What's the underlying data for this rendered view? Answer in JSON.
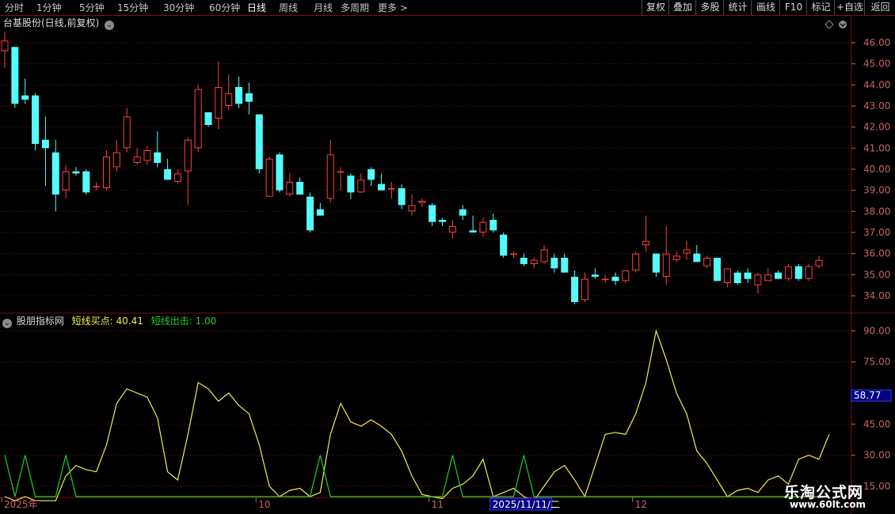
{
  "toolbar": {
    "periods": [
      {
        "label": "分时",
        "active": false
      },
      {
        "label": "1分钟",
        "active": false
      },
      {
        "label": "5分钟",
        "active": false
      },
      {
        "label": "15分钟",
        "active": false
      },
      {
        "label": "30分钟",
        "active": false
      },
      {
        "label": "60分钟",
        "active": false
      },
      {
        "label": "日线",
        "active": true
      },
      {
        "label": "周线",
        "active": false
      },
      {
        "label": "月线",
        "active": false
      },
      {
        "label": "多周期",
        "active": false
      },
      {
        "label": "更多 >",
        "active": false
      }
    ],
    "tools": [
      "复权",
      "叠加",
      "多股",
      "统计",
      "画线",
      "F10",
      "标记",
      "+自选",
      "返回"
    ]
  },
  "main_header": {
    "title": "台基股份(日线,前复权)",
    "dropdown_icon": "chevron-down-icon"
  },
  "sub_header": {
    "title": "股朋指标网",
    "l1_label": "短线买点: 40.41",
    "l2_label": "短线出击: 1.00"
  },
  "colors": {
    "up": "#ff4040",
    "down": "#54fcfc",
    "line1": "#f0f050",
    "line2": "#20d020",
    "grid": "#7a1010",
    "axis": "#c86464"
  },
  "chart_data": [
    {
      "type": "candlestick",
      "title": "台基股份(日线,前复权)",
      "ylim": [
        33.4,
        46.6
      ],
      "yticks": [
        34,
        35,
        36,
        37,
        38,
        39,
        40,
        41,
        42,
        43,
        44,
        45,
        46
      ],
      "ytick_labels": [
        "34.00",
        "35.00",
        "36.00",
        "37.00",
        "38.00",
        "39.00",
        "40.00",
        "41.00",
        "42.00",
        "43.00",
        "44.00",
        "45.00",
        "46.00"
      ],
      "candles": [
        {
          "o": 45.6,
          "h": 46.5,
          "l": 44.8,
          "c": 46.1
        },
        {
          "o": 45.8,
          "h": 45.8,
          "l": 42.9,
          "c": 43.1
        },
        {
          "o": 43.5,
          "h": 44.3,
          "l": 43.1,
          "c": 43.3
        },
        {
          "o": 43.5,
          "h": 43.6,
          "l": 40.9,
          "c": 41.2
        },
        {
          "o": 41.4,
          "h": 42.5,
          "l": 39.2,
          "c": 41.0
        },
        {
          "o": 40.8,
          "h": 41.4,
          "l": 38.0,
          "c": 38.8
        },
        {
          "o": 39.0,
          "h": 40.2,
          "l": 38.6,
          "c": 39.9
        },
        {
          "o": 39.9,
          "h": 40.1,
          "l": 39.7,
          "c": 39.8
        },
        {
          "o": 39.9,
          "h": 40.0,
          "l": 38.8,
          "c": 38.9
        },
        {
          "o": 39.2,
          "h": 39.4,
          "l": 39.0,
          "c": 39.2
        },
        {
          "o": 39.1,
          "h": 40.9,
          "l": 39.0,
          "c": 40.6
        },
        {
          "o": 40.1,
          "h": 41.4,
          "l": 39.9,
          "c": 40.8
        },
        {
          "o": 41.0,
          "h": 42.9,
          "l": 40.8,
          "c": 42.5
        },
        {
          "o": 40.3,
          "h": 41.0,
          "l": 40.2,
          "c": 40.6
        },
        {
          "o": 40.4,
          "h": 41.1,
          "l": 40.2,
          "c": 40.9
        },
        {
          "o": 40.8,
          "h": 41.8,
          "l": 40.1,
          "c": 40.3
        },
        {
          "o": 40.0,
          "h": 40.5,
          "l": 39.5,
          "c": 39.5
        },
        {
          "o": 39.4,
          "h": 40.0,
          "l": 39.3,
          "c": 39.8
        },
        {
          "o": 39.9,
          "h": 41.5,
          "l": 38.3,
          "c": 41.4
        },
        {
          "o": 41.0,
          "h": 44.0,
          "l": 40.8,
          "c": 43.8
        },
        {
          "o": 42.7,
          "h": 42.7,
          "l": 42.0,
          "c": 42.1
        },
        {
          "o": 42.4,
          "h": 45.1,
          "l": 41.9,
          "c": 43.9
        },
        {
          "o": 43.0,
          "h": 44.5,
          "l": 42.8,
          "c": 43.6
        },
        {
          "o": 43.9,
          "h": 44.4,
          "l": 42.9,
          "c": 43.1
        },
        {
          "o": 43.6,
          "h": 44.1,
          "l": 42.6,
          "c": 43.2
        },
        {
          "o": 42.6,
          "h": 42.6,
          "l": 39.8,
          "c": 40.0
        },
        {
          "o": 38.7,
          "h": 40.6,
          "l": 38.7,
          "c": 40.5
        },
        {
          "o": 40.7,
          "h": 40.8,
          "l": 38.9,
          "c": 39.0
        },
        {
          "o": 38.8,
          "h": 39.8,
          "l": 38.7,
          "c": 39.4
        },
        {
          "o": 39.4,
          "h": 39.6,
          "l": 38.8,
          "c": 38.8
        },
        {
          "o": 38.7,
          "h": 38.9,
          "l": 37.0,
          "c": 37.1
        },
        {
          "o": 38.1,
          "h": 38.4,
          "l": 37.9,
          "c": 37.8
        },
        {
          "o": 38.6,
          "h": 41.4,
          "l": 38.4,
          "c": 40.7
        },
        {
          "o": 39.9,
          "h": 40.1,
          "l": 39.0,
          "c": 39.9
        },
        {
          "o": 39.7,
          "h": 39.8,
          "l": 38.6,
          "c": 38.9
        },
        {
          "o": 38.9,
          "h": 39.8,
          "l": 38.9,
          "c": 39.5
        },
        {
          "o": 40.0,
          "h": 40.1,
          "l": 39.2,
          "c": 39.5
        },
        {
          "o": 39.3,
          "h": 39.8,
          "l": 39.0,
          "c": 39.0
        },
        {
          "o": 39.1,
          "h": 39.4,
          "l": 38.6,
          "c": 39.1
        },
        {
          "o": 39.1,
          "h": 39.3,
          "l": 38.1,
          "c": 38.3
        },
        {
          "o": 38.0,
          "h": 38.8,
          "l": 37.8,
          "c": 38.3
        },
        {
          "o": 38.4,
          "h": 38.6,
          "l": 38.2,
          "c": 38.5
        },
        {
          "o": 38.3,
          "h": 38.4,
          "l": 37.3,
          "c": 37.5
        },
        {
          "o": 37.6,
          "h": 37.7,
          "l": 37.3,
          "c": 37.5
        },
        {
          "o": 37.0,
          "h": 37.6,
          "l": 36.7,
          "c": 37.3
        },
        {
          "o": 38.1,
          "h": 38.3,
          "l": 37.6,
          "c": 37.8
        },
        {
          "o": 37.1,
          "h": 37.8,
          "l": 37.0,
          "c": 37.0
        },
        {
          "o": 37.0,
          "h": 37.7,
          "l": 36.8,
          "c": 37.5
        },
        {
          "o": 37.6,
          "h": 37.9,
          "l": 37.0,
          "c": 37.1
        },
        {
          "o": 36.9,
          "h": 37.0,
          "l": 35.8,
          "c": 35.9
        },
        {
          "o": 36.0,
          "h": 36.1,
          "l": 35.8,
          "c": 36.0
        },
        {
          "o": 35.8,
          "h": 36.0,
          "l": 35.4,
          "c": 35.5
        },
        {
          "o": 35.5,
          "h": 35.8,
          "l": 35.3,
          "c": 35.7
        },
        {
          "o": 35.6,
          "h": 36.4,
          "l": 35.5,
          "c": 36.2
        },
        {
          "o": 35.8,
          "h": 36.0,
          "l": 35.1,
          "c": 35.3
        },
        {
          "o": 35.8,
          "h": 36.0,
          "l": 35.1,
          "c": 35.1
        },
        {
          "o": 34.9,
          "h": 35.2,
          "l": 33.6,
          "c": 33.7
        },
        {
          "o": 33.8,
          "h": 35.1,
          "l": 33.7,
          "c": 34.8
        },
        {
          "o": 35.0,
          "h": 35.3,
          "l": 34.8,
          "c": 34.9
        },
        {
          "o": 34.8,
          "h": 35.0,
          "l": 34.6,
          "c": 34.8
        },
        {
          "o": 34.9,
          "h": 35.1,
          "l": 34.5,
          "c": 34.7
        },
        {
          "o": 34.7,
          "h": 35.1,
          "l": 34.6,
          "c": 35.2
        },
        {
          "o": 35.2,
          "h": 36.1,
          "l": 35.1,
          "c": 36.0
        },
        {
          "o": 36.4,
          "h": 37.8,
          "l": 36.1,
          "c": 36.6
        },
        {
          "o": 36.0,
          "h": 36.0,
          "l": 34.9,
          "c": 35.1
        },
        {
          "o": 34.9,
          "h": 37.3,
          "l": 34.5,
          "c": 36.0
        },
        {
          "o": 35.7,
          "h": 36.1,
          "l": 35.6,
          "c": 35.9
        },
        {
          "o": 36.0,
          "h": 36.6,
          "l": 35.7,
          "c": 36.2
        },
        {
          "o": 36.0,
          "h": 36.4,
          "l": 35.6,
          "c": 35.6
        },
        {
          "o": 35.4,
          "h": 35.9,
          "l": 35.3,
          "c": 35.8
        },
        {
          "o": 35.8,
          "h": 35.8,
          "l": 34.8,
          "c": 34.7
        },
        {
          "o": 34.6,
          "h": 35.3,
          "l": 34.4,
          "c": 35.3
        },
        {
          "o": 35.1,
          "h": 35.2,
          "l": 34.5,
          "c": 34.6
        },
        {
          "o": 35.1,
          "h": 35.3,
          "l": 34.6,
          "c": 34.8
        },
        {
          "o": 34.5,
          "h": 35.1,
          "l": 34.1,
          "c": 35.0
        },
        {
          "o": 34.7,
          "h": 35.3,
          "l": 34.7,
          "c": 35.0
        },
        {
          "o": 35.1,
          "h": 35.2,
          "l": 34.8,
          "c": 34.8
        },
        {
          "o": 34.8,
          "h": 35.5,
          "l": 34.7,
          "c": 35.4
        },
        {
          "o": 35.4,
          "h": 35.5,
          "l": 34.7,
          "c": 34.8
        },
        {
          "o": 34.8,
          "h": 35.5,
          "l": 34.7,
          "c": 35.4
        },
        {
          "o": 35.4,
          "h": 35.9,
          "l": 35.3,
          "c": 35.7
        }
      ]
    },
    {
      "type": "line",
      "title": "股朋指标网",
      "ylim": [
        10,
        97
      ],
      "yticks": [
        15,
        30,
        45,
        75,
        90
      ],
      "ytick_labels": [
        "15.00",
        "30.00",
        "45.00",
        "75.00",
        "90.00"
      ],
      "current_marker": {
        "value": 58.77,
        "label": "58.77"
      },
      "x_labels": [
        {
          "index": 0,
          "label": "2025年"
        },
        {
          "index": 25,
          "label": "10"
        },
        {
          "index": 42,
          "label": "11"
        },
        {
          "index": 48,
          "label": "2025/11/11/二"
        },
        {
          "index": 62,
          "label": "12"
        }
      ],
      "series": [
        {
          "name": "短线买点",
          "values": [
            10,
            8,
            10,
            8,
            8,
            8,
            20,
            25,
            23,
            22,
            35,
            55,
            62,
            60,
            58,
            48,
            22,
            18,
            40,
            65,
            62,
            56,
            60,
            54,
            50,
            35,
            15,
            10,
            13,
            14,
            10,
            12,
            40,
            55,
            46,
            44,
            47,
            44,
            40,
            32,
            20,
            11,
            10,
            9,
            14,
            16,
            20,
            28,
            10,
            12,
            14,
            10,
            8,
            15,
            22,
            25,
            18,
            10,
            25,
            40,
            41,
            40,
            50,
            65,
            90,
            76,
            60,
            50,
            32,
            26,
            18,
            10,
            13,
            14,
            12,
            18,
            20,
            16,
            28,
            30,
            28,
            40
          ]
        },
        {
          "name": "短线出击",
          "values": [
            30,
            10,
            30,
            10,
            10,
            10,
            30,
            10,
            10,
            10,
            10,
            10,
            10,
            10,
            10,
            10,
            10,
            10,
            10,
            10,
            10,
            10,
            10,
            10,
            10,
            10,
            10,
            10,
            10,
            10,
            10,
            30,
            10,
            10,
            10,
            10,
            10,
            10,
            10,
            10,
            10,
            10,
            10,
            10,
            30,
            10,
            10,
            10,
            10,
            10,
            10,
            30,
            10,
            10,
            10,
            10,
            10,
            10,
            10,
            10,
            10,
            10,
            10,
            10,
            10,
            10,
            10,
            10,
            10,
            10,
            10,
            10,
            10,
            10,
            10,
            10,
            10,
            10,
            10,
            10,
            10,
            10
          ]
        }
      ]
    }
  ],
  "watermark": {
    "line1": "乐淘公式网",
    "line2": "www.60lt.com"
  }
}
